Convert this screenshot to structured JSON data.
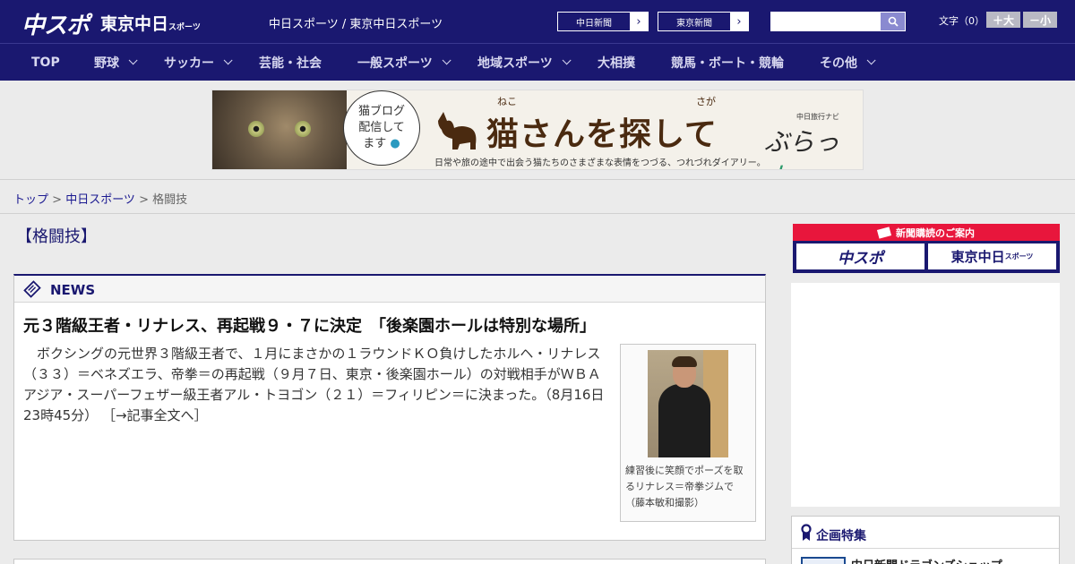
{
  "header": {
    "logo_chuspo": "中スポ",
    "logo_tokyo": "東京中日",
    "logo_tokyo_small": "スポーツ",
    "site_title": "中日スポーツ / 東京中日スポーツ",
    "link_chunichi": "中日新聞",
    "link_tokyo": "東京新聞",
    "search_placeholder": "",
    "font_size_label": "文字（0）",
    "font_larger": "＋大",
    "font_smaller": "－小"
  },
  "nav": {
    "items": [
      {
        "label": "TOP"
      },
      {
        "label": "野球"
      },
      {
        "label": "サッカー"
      },
      {
        "label": "芸能・社会"
      },
      {
        "label": "一般スポーツ"
      },
      {
        "label": "地域スポーツ"
      },
      {
        "label": "大相撲"
      },
      {
        "label": "競馬・ボート・競輪"
      },
      {
        "label": "その他"
      }
    ]
  },
  "banner": {
    "bubble_line1": "猫ブログ",
    "bubble_line2": "配信して",
    "bubble_line3": "ます",
    "title": "猫さんを探して",
    "ruby_neko": "ねこ",
    "ruby_saga": "さが",
    "subtitle": "日常や旅の途中で出会う猫たちのさまざまな表情をつづる、つれづれダイアリー。",
    "brand_small": "中日旅行ナビ",
    "brand": "ぶらっ",
    "brand_accent": "人"
  },
  "breadcrumb": {
    "top": "トップ",
    "sep": " > ",
    "section": "中日スポーツ",
    "current": "格闘技"
  },
  "page": {
    "title": "【格闘技】"
  },
  "news": {
    "heading": "NEWS",
    "article": {
      "title": "元３階級王者・リナレス、再起戦９・７に決定　「後楽園ホールは特別な場所」",
      "body": "　ボクシングの元世界３階級王者で、１月にまさかの１ラウンドＫＯ負けしたホルヘ・リナレス（３３）＝ベネズエラ、帝拳＝の再起戦（９月７日、東京・後楽園ホール）の対戦相手がＷＢＡアジア・スーパーフェザー級王者アル・トヨゴン（２１）＝フィリピン＝に決まった。（8月16日 23時45分）",
      "more": "［→記事全文へ］",
      "caption": "練習後に笑顔でポーズを取るリナレス＝帝拳ジムで（藤本敏和撮影）"
    }
  },
  "sidebar": {
    "subscribe_heading": "新聞購読のご案内",
    "sub_chuspo": "中スポ",
    "sub_tokyo": "東京中日",
    "sub_tokyo_small": "スポーツ",
    "feature_heading": "企画特集",
    "feature_item": "中日新聞ドラゴンズショップ"
  },
  "colors": {
    "brand_navy": "#1a1870",
    "subscribe_red": "#e8163c"
  }
}
